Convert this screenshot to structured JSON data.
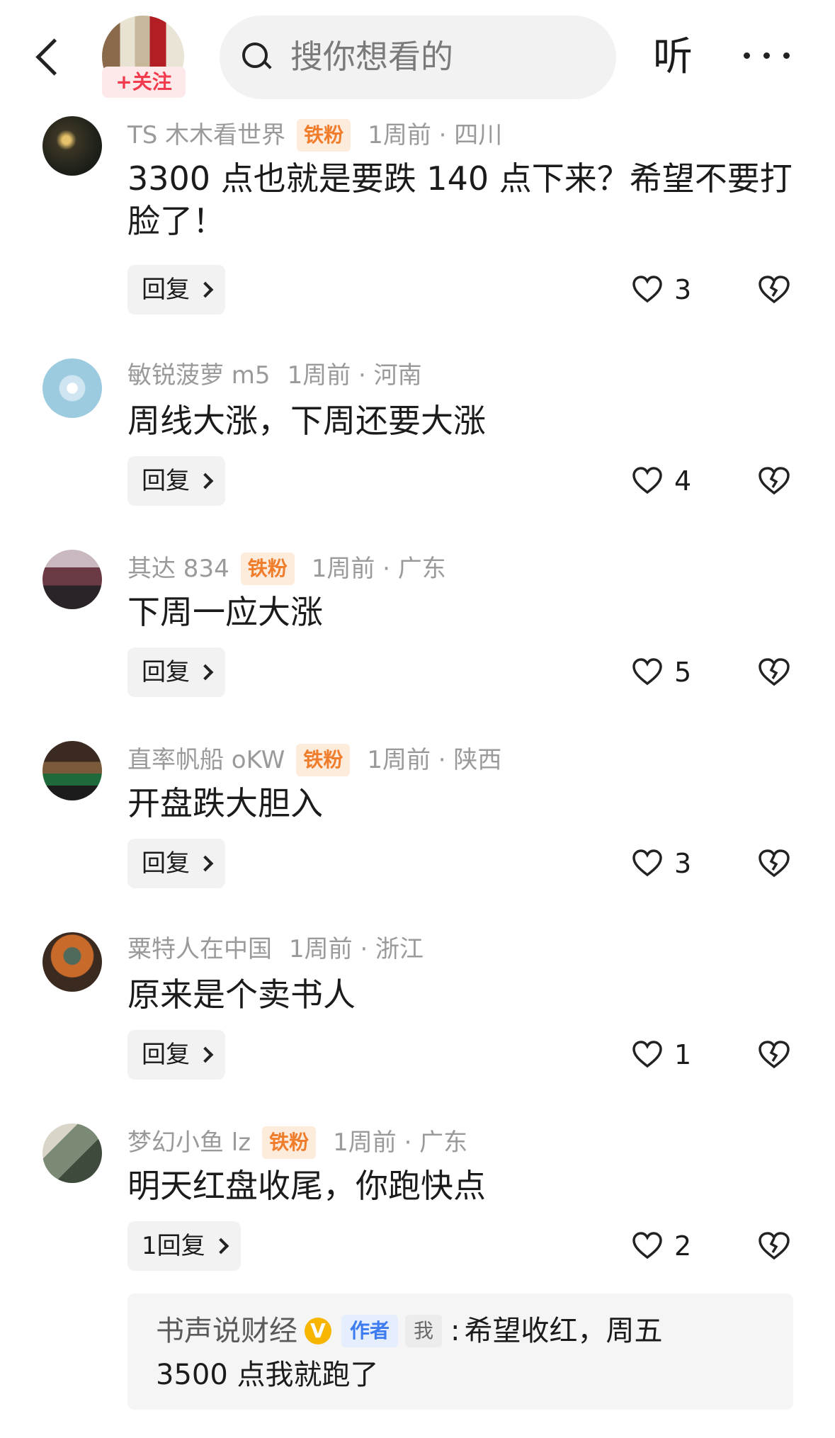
{
  "header": {
    "follow_label": "+关注",
    "search_placeholder": "搜你想看的",
    "listen_label": "听"
  },
  "comments": [
    {
      "name": "TS 木木看世界",
      "badge": "铁粉",
      "time": "1周前 · 四川",
      "text": "3300 点也就是要跌 140 点下来？希望不要打脸了！",
      "reply_label": "回复",
      "likes": "3"
    },
    {
      "name": "敏锐菠萝 m5",
      "badge": "",
      "time": "1周前 · 河南",
      "text": "周线大涨，下周还要大涨",
      "reply_label": "回复",
      "likes": "4"
    },
    {
      "name": "其达 834",
      "badge": "铁粉",
      "time": "1周前 · 广东",
      "text": "下周一应大涨",
      "reply_label": "回复",
      "likes": "5"
    },
    {
      "name": "直率帆船 oKW",
      "badge": "铁粉",
      "time": "1周前 · 陕西",
      "text": "开盘跌大胆入",
      "reply_label": "回复",
      "likes": "3"
    },
    {
      "name": "粟特人在中国",
      "badge": "",
      "time": "1周前 · 浙江",
      "text": "原来是个卖书人",
      "reply_label": "回复",
      "likes": "1"
    },
    {
      "name": "梦幻小鱼 lz",
      "badge": "铁粉",
      "time": "1周前 · 广东",
      "text": "明天红盘收尾，你跑快点",
      "reply_label": "1回复",
      "likes": "2"
    }
  ],
  "author_reply": {
    "name": "书声说财经",
    "verified": "V",
    "author_tag": "作者",
    "me_tag": "我",
    "text_line1": "希望收红，周五",
    "text_line2": "3500 点我就跑了"
  },
  "colors": {
    "accent_red": "#f23b4d",
    "fan_badge": "#f07d2b",
    "author_badge": "#3c7cf0",
    "verified": "#f7b500"
  }
}
